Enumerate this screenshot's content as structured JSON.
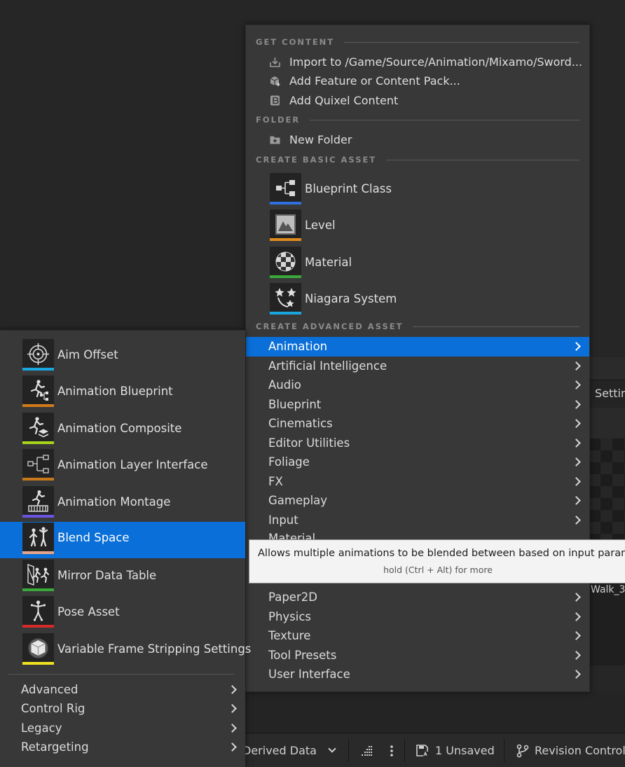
{
  "background": {
    "settings_tab_partial": "Settin",
    "asset_label_partial": "Walk_3"
  },
  "status_bar": {
    "derived_data": "Derived Data",
    "unsaved": "1 Unsaved",
    "revision_control": "Revision Control"
  },
  "menu": {
    "sections": {
      "get_content": "GET CONTENT",
      "folder": "FOLDER",
      "create_basic": "CREATE BASIC ASSET",
      "create_advanced": "CREATE ADVANCED ASSET"
    },
    "get_content_items": [
      {
        "label": "Import to /Game/Source/Animation/Mixamo/Sword...",
        "icon": "import-icon"
      },
      {
        "label": "Add Feature or Content Pack...",
        "icon": "feature-pack-icon"
      },
      {
        "label": "Add Quixel Content",
        "icon": "quixel-icon"
      }
    ],
    "folder_items": [
      {
        "label": "New Folder",
        "icon": "new-folder-icon"
      }
    ],
    "basic_assets": [
      {
        "label": "Blueprint Class",
        "color": "#2f6fe0",
        "icon": "blueprint-class-icon"
      },
      {
        "label": "Level",
        "color": "#e08a1e",
        "icon": "level-icon"
      },
      {
        "label": "Material",
        "color": "#3aa83a",
        "icon": "material-icon"
      },
      {
        "label": "Niagara System",
        "color": "#1aa7e0",
        "icon": "niagara-icon"
      }
    ],
    "advanced_categories": [
      {
        "label": "Animation",
        "active": true
      },
      {
        "label": "Artificial Intelligence"
      },
      {
        "label": "Audio"
      },
      {
        "label": "Blueprint"
      },
      {
        "label": "Cinematics"
      },
      {
        "label": "Editor Utilities"
      },
      {
        "label": "Foliage"
      },
      {
        "label": "FX"
      },
      {
        "label": "Gameplay"
      },
      {
        "label": "Input"
      },
      {
        "label": "Material"
      },
      {
        "label": "Paper2D"
      },
      {
        "label": "Physics"
      },
      {
        "label": "Texture"
      },
      {
        "label": "Tool Presets"
      },
      {
        "label": "User Interface"
      }
    ]
  },
  "submenu": {
    "items": [
      {
        "label": "Aim Offset",
        "color": "#1aa7e0",
        "icon": "aim-offset-icon"
      },
      {
        "label": "Animation Blueprint",
        "color": "#d07a1a",
        "icon": "animation-blueprint-icon"
      },
      {
        "label": "Animation Composite",
        "color": "#a8d41c",
        "icon": "animation-composite-icon"
      },
      {
        "label": "Animation Layer Interface",
        "color": "#c8781a",
        "icon": "animation-layer-interface-icon"
      },
      {
        "label": "Animation Montage",
        "color": "#6a54e0",
        "icon": "animation-montage-icon"
      },
      {
        "label": "Blend Space",
        "color": "#e8a48a",
        "icon": "blend-space-icon",
        "active": true
      },
      {
        "label": "Mirror Data Table",
        "color": "#3aa83a",
        "icon": "mirror-data-table-icon"
      },
      {
        "label": "Pose Asset",
        "color": "#d42a2a",
        "icon": "pose-asset-icon"
      },
      {
        "label": "Variable Frame Stripping Settings",
        "color": "#f0e020",
        "icon": "variable-frame-stripping-icon"
      }
    ],
    "categories": [
      {
        "label": "Advanced"
      },
      {
        "label": "Control Rig"
      },
      {
        "label": "Legacy"
      },
      {
        "label": "Retargeting"
      }
    ]
  },
  "tooltip": {
    "text": "Allows multiple animations to be blended between based on input paramete",
    "hint": "hold (Ctrl + Alt) for more"
  }
}
